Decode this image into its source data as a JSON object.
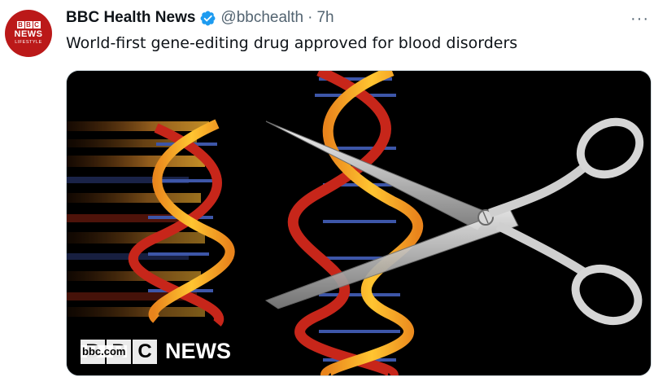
{
  "avatar": {
    "bbc_letters": [
      "B",
      "B",
      "C"
    ],
    "news": "NEWS",
    "subtitle": "LIFESTYLE",
    "brand_color": "#bb1919"
  },
  "tweet": {
    "author_name": "BBC Health News",
    "handle": "@bbchealth",
    "separator": "·",
    "time": "7h",
    "text": "World-first gene-editing drug approved for blood disorders",
    "verified_color": "#1d9bf0",
    "more_icon": "···"
  },
  "media": {
    "watermark_letters": [
      "B",
      "B",
      "C"
    ],
    "watermark_url": "bbc.com",
    "watermark_news": "NEWS"
  }
}
